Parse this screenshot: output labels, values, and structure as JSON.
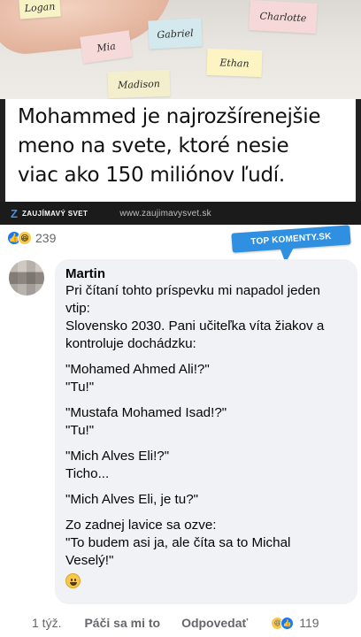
{
  "photo": {
    "notes": [
      "Logan",
      "Charlotte",
      "Gabriel",
      "Mia",
      "Ethan",
      "Madison"
    ]
  },
  "headline": {
    "lines": [
      "Mohammed je najrozšírenejšie",
      "meno na svete, ktoré nesie",
      "viac ako 150 miliónov ľudí."
    ]
  },
  "source": {
    "logo_letter": "Z",
    "brand": "ZAUJÍMAVÝ SVET",
    "url": "www.zaujimavysvet.sk"
  },
  "post_reactions": {
    "icons": [
      "like-icon",
      "haha-icon"
    ],
    "count": "239"
  },
  "badge": {
    "label": "TOP KOMENTY.SK"
  },
  "comment": {
    "author": "Martin",
    "text_lines": [
      "Pri čítaní tohto príspevku mi napadol jeden",
      "vtip:",
      "Slovensko 2030. Pani učiteľka víta žiakov a",
      "kontroluje dochádzku:",
      "\"Mohamed Ahmed Ali!?\"",
      "\"Tu!\"",
      "\"Mustafa Mohamed Isad!?\"",
      "\"Tu!\"",
      "\"Mich Alves Eli!?\"",
      "Ticho...",
      "\"Mich Alves Eli, je tu?\"",
      "Zo zadnej lavice sa ozve:",
      "\"To budem asi ja, ale číta sa to Michal",
      "Veselý!\""
    ],
    "emoji": "grinning-face"
  },
  "comment_actions": {
    "time": "1 týž.",
    "like_label": "Páči sa mi to",
    "reply_label": "Odpovedať",
    "reaction_icons": [
      "haha-icon",
      "like-icon"
    ],
    "reaction_count": "119"
  },
  "colors": {
    "facebook_blue": "#1877f2",
    "badge_blue": "#2f8fe0",
    "bubble_bg": "#f0f2f5",
    "secondary_text": "#65676b",
    "source_bar_bg": "#1b1b1b"
  }
}
